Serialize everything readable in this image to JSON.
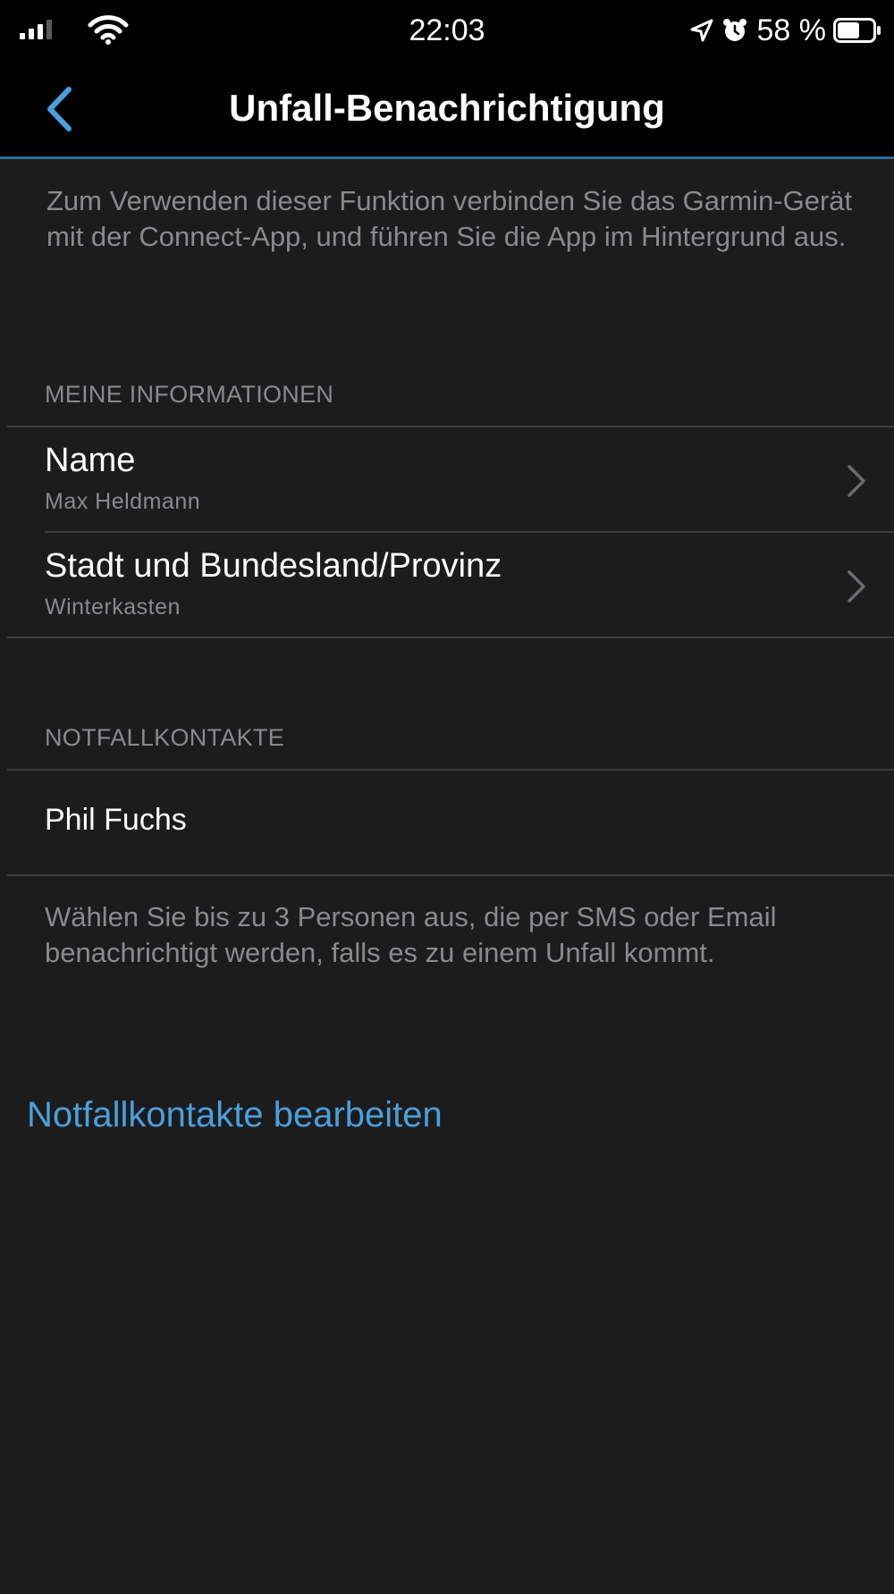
{
  "status_bar": {
    "time": "22:03",
    "battery_percent": "58 %",
    "signal_icon": "cellular-signal-icon",
    "wifi_icon": "wifi-icon",
    "location_icon": "location-arrow-icon",
    "alarm_icon": "alarm-clock-icon",
    "battery_icon": "battery-icon"
  },
  "nav": {
    "title": "Unfall-Benachrichtigung",
    "back_icon": "chevron-left-icon"
  },
  "intro": {
    "text": "Zum Verwenden dieser Funktion verbinden Sie das Garmin-Gerät mit der Connect-App, und führen Sie die App im Hintergrund aus."
  },
  "my_info": {
    "header": "MEINE INFORMATIONEN",
    "items": [
      {
        "title": "Name",
        "value": "Max Heldmann"
      },
      {
        "title": "Stadt und Bundesland/Provinz",
        "value": "Winterkasten"
      }
    ]
  },
  "emergency_contacts": {
    "header": "NOTFALLKONTAKTE",
    "contacts": [
      "Phil Fuchs"
    ],
    "footer": "Wählen Sie bis zu 3 Personen aus, die per SMS oder Email benachrichtigt werden, falls es zu einem Unfall kommt.",
    "edit_label": "Notfallkontakte bearbeiten"
  },
  "colors": {
    "background": "#1c1c1c",
    "bar_background": "#000000",
    "accent": "#4a9fdc",
    "secondary_text": "#8a8a8e"
  }
}
